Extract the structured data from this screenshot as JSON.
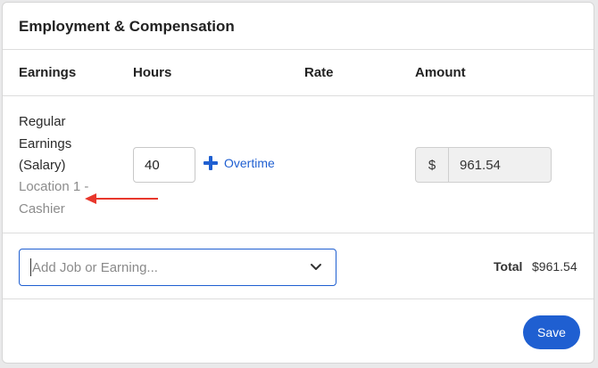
{
  "section": {
    "title": "Employment & Compensation"
  },
  "columns": {
    "earnings": "Earnings",
    "hours": "Hours",
    "rate": "Rate",
    "amount": "Amount"
  },
  "row": {
    "earning_name": "Regular Earnings (Salary)",
    "location": "Location 1 - Cashier",
    "hours_value": "40",
    "overtime_label": "Overtime",
    "currency_symbol": "$",
    "amount_value": "961.54"
  },
  "add_job": {
    "placeholder": "Add Job or Earning..."
  },
  "total": {
    "label": "Total",
    "value": "$961.54"
  },
  "actions": {
    "save_label": "Save"
  },
  "colors": {
    "accent": "#1f5fd1",
    "annotation_arrow": "#e8372c"
  },
  "icons": [
    "plus-icon",
    "chevron-down-icon",
    "arrow-annotation"
  ]
}
